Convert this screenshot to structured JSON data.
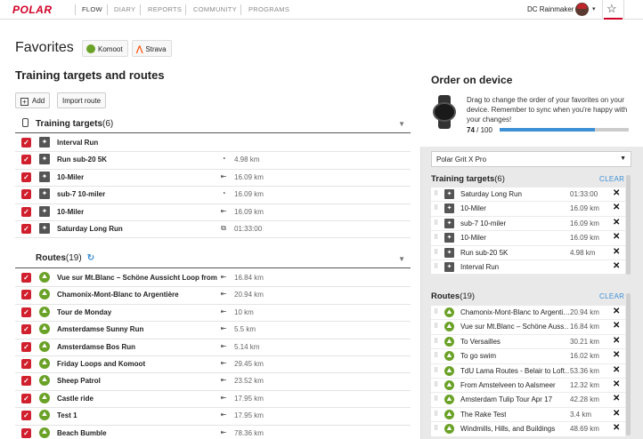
{
  "nav": {
    "logo": "POLAR",
    "items": [
      "FLOW",
      "DIARY",
      "REPORTS",
      "COMMUNITY",
      "PROGRAMS"
    ],
    "user": "DC Rainmaker",
    "caret": "▾",
    "star_icon": "star-icon"
  },
  "favorites": {
    "title": "Favorites",
    "komoot": "Komoot",
    "strava": "Strava"
  },
  "section": {
    "title": "Training targets and routes",
    "add_label": "Add",
    "import_label": "Import route"
  },
  "training_targets": {
    "label": "Training targets",
    "count": "(6)",
    "items": [
      {
        "name": "Interval Run",
        "type": "",
        "value": ""
      },
      {
        "name": "Run sub-20 5K",
        "type": "◔",
        "value": "4.98 km"
      },
      {
        "name": "10-Miler",
        "type": "⇤",
        "value": "16.09 km"
      },
      {
        "name": "sub-7 10-miler",
        "type": "◔",
        "value": "16.09 km"
      },
      {
        "name": "10-Miler",
        "type": "⇤",
        "value": "16.09 km"
      },
      {
        "name": "Saturday Long Run",
        "type": "⧉",
        "value": "01:33:00"
      }
    ]
  },
  "routes": {
    "label": "Routes",
    "count": "(19)",
    "items": [
      {
        "name": "Vue sur Mt.Blanc – Schöne Aussicht Loop from",
        "value": "16.84 km"
      },
      {
        "name": "Chamonix-Mont-Blanc to Argentière",
        "value": "20.94 km"
      },
      {
        "name": "Tour de Monday",
        "value": "10 km"
      },
      {
        "name": "Amsterdamse Sunny Run",
        "value": "5.5 km"
      },
      {
        "name": "Amsterdamse Bos Run",
        "value": "5.14 km"
      },
      {
        "name": "Friday Loops and Komoot",
        "value": "29.45 km"
      },
      {
        "name": "Sheep Patrol",
        "value": "23.52 km"
      },
      {
        "name": "Castle ride",
        "value": "17.95 km"
      },
      {
        "name": "Test 1",
        "value": "17.95 km"
      },
      {
        "name": "Beach Bumble",
        "value": "78.36 km"
      }
    ]
  },
  "order": {
    "title": "Order on device",
    "description": "Drag to change the order of your favorites on your device. Remember to sync when you're happy with your changes!",
    "used": "74",
    "total": "/ 100",
    "progress_fraction": 0.74,
    "device": "Polar Grit X Pro",
    "clear_label": "CLEAR",
    "targets_label": "Training targets",
    "targets_count": "(6)",
    "targets": [
      {
        "name": "Saturday Long Run",
        "value": "01:33:00"
      },
      {
        "name": "10-Miler",
        "value": "16.09 km"
      },
      {
        "name": "sub-7 10-miler",
        "value": "16.09 km"
      },
      {
        "name": "10-Miler",
        "value": "16.09 km"
      },
      {
        "name": "Run sub-20 5K",
        "value": "4.98 km"
      },
      {
        "name": "Interval Run",
        "value": ""
      }
    ],
    "routes_label": "Routes",
    "routes_count": "(19)",
    "routes": [
      {
        "name": "Chamonix-Mont-Blanc to Argenti…",
        "value": "20.94 km"
      },
      {
        "name": "Vue sur Mt.Blanc – Schöne Auss…",
        "value": "16.84 km"
      },
      {
        "name": "To Versailles",
        "value": "30.21 km"
      },
      {
        "name": "To go swim",
        "value": "16.02 km"
      },
      {
        "name": "TdU Lama Routes - Belair to Loft…",
        "value": "53.36 km"
      },
      {
        "name": "From Amstelveen to Aalsmeer",
        "value": "12.32 km"
      },
      {
        "name": "Amsterdam Tulip Tour Apr 17",
        "value": "42.28 km"
      },
      {
        "name": "The Rake Test",
        "value": "3.4 km"
      },
      {
        "name": "Windmills, Hills, and Buildings",
        "value": "48.69 km"
      }
    ]
  },
  "colors": {
    "brand": "#d10027",
    "accent": "#3d8fd6",
    "checkbox": "#d0202e",
    "route": "#6aa127"
  }
}
